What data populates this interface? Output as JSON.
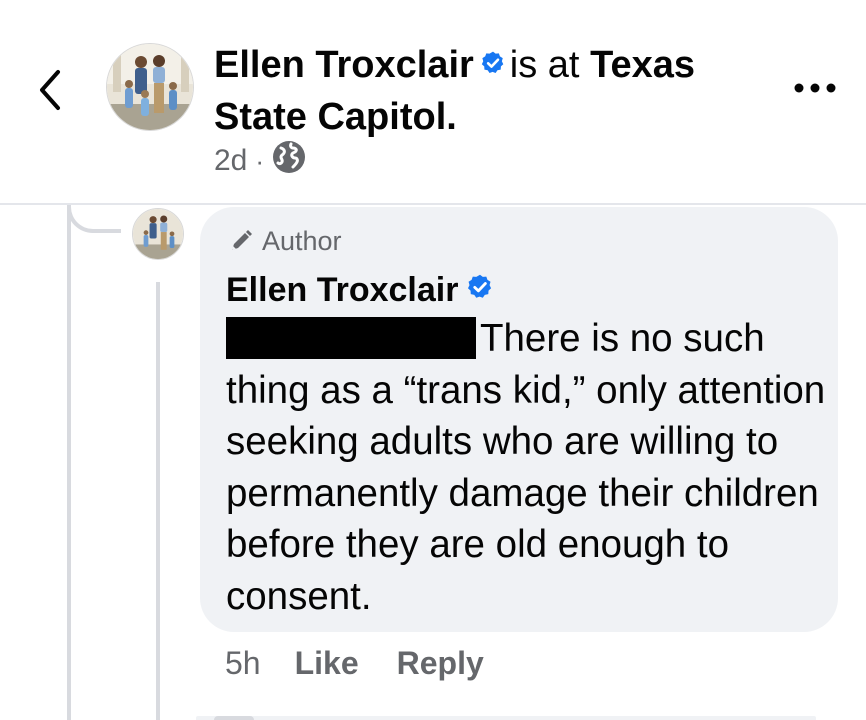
{
  "header": {
    "author_name": "Ellen Troxclair",
    "at_text": "is at",
    "place_line1": "Texas",
    "place_line2": "State Capitol.",
    "time": "2d",
    "separator": "·",
    "privacy_icon": "globe-icon",
    "back_icon": "chevron-left-icon",
    "more_icon": "more-horizontal-icon"
  },
  "comment": {
    "badge_icon": "pencil-icon",
    "badge_label": "Author",
    "author_name": "Ellen Troxclair",
    "body_line1": "There is no such",
    "body_rest": "thing as a “trans kid,” only attention seeking adults who are willing to permanently damage their children before they are old enough to consent.",
    "time": "5h",
    "like_label": "Like",
    "reply_label": "Reply"
  },
  "colors": {
    "verified_blue": "#1877f2",
    "secondary_text": "#65676b",
    "bubble_bg": "#f0f2f5",
    "redaction": "#000000"
  }
}
